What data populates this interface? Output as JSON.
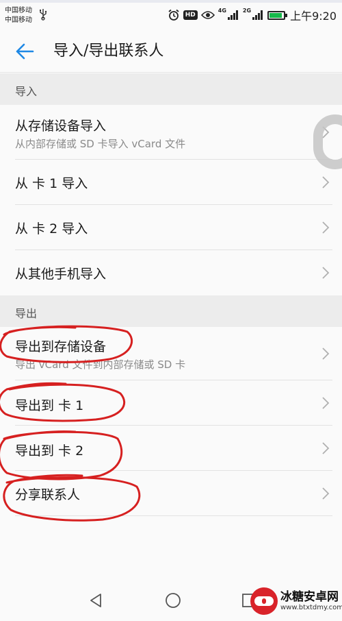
{
  "status_bar": {
    "carriers": [
      "中国移动",
      "中国移动"
    ],
    "network_labels": [
      "4G",
      "2G"
    ],
    "hd_label": "HD",
    "battery_level": 0.9,
    "time": "上午9:20"
  },
  "app_bar": {
    "title": "导入/导出联系人"
  },
  "sections": [
    {
      "header": "导入",
      "items": [
        {
          "title": "从存储设备导入",
          "subtitle": "从内部存储或 SD 卡导入 vCard 文件"
        },
        {
          "title": "从 卡 1 导入"
        },
        {
          "title": "从 卡 2 导入"
        },
        {
          "title": "从其他手机导入"
        }
      ]
    },
    {
      "header": "导出",
      "items": [
        {
          "title": "导出到存储设备",
          "subtitle": "导出 vCard 文件到内部存储或 SD 卡"
        },
        {
          "title": "导出到 卡 1"
        },
        {
          "title": "导出到 卡 2"
        },
        {
          "title": "分享联系人"
        }
      ]
    }
  ],
  "watermark": {
    "title": "冰糖安卓网",
    "url": "www.btxtdmy.com"
  },
  "colors": {
    "accent": "#1e88e5",
    "annotation": "#d62020",
    "battery": "#16b84a"
  }
}
